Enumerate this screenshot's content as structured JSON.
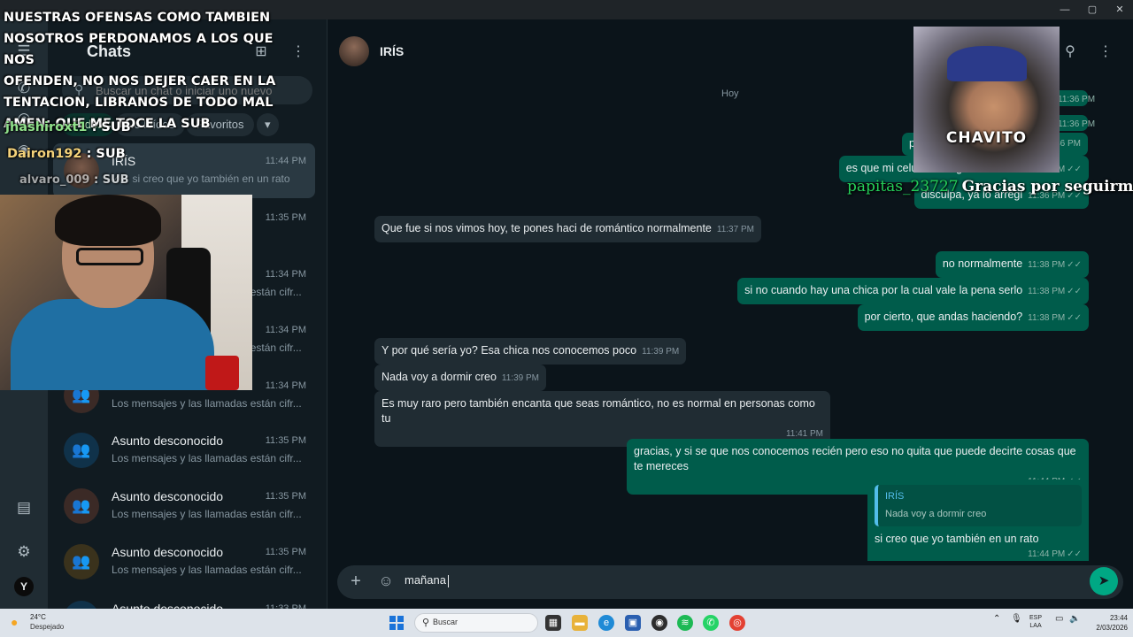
{
  "window": {
    "minimize": "—",
    "maximize": "▢",
    "close": "✕"
  },
  "sidebar_list": {
    "title": "Chats",
    "search_placeholder": "Buscar un chat o iniciar uno nuevo",
    "filters": [
      "Todos",
      "No leídos",
      "Favoritos"
    ],
    "chats": [
      {
        "name": "IRÍS",
        "time": "11:44 PM",
        "preview": "✓✓ si creo que yo también en un rato",
        "avatar": "photo",
        "selected": true
      },
      {
        "name": "",
        "time": "11:35 PM",
        "preview": "",
        "avatar": "blue"
      },
      {
        "name": "",
        "time": "11:34 PM",
        "preview": "Los mensajes y las llamadas están cifr...",
        "avatar": "blue"
      },
      {
        "name": "",
        "time": "11:34 PM",
        "preview": "Los mensajes y las llamadas están cifr...",
        "avatar": "gold"
      },
      {
        "name": "",
        "time": "11:34 PM",
        "preview": "Los mensajes y las llamadas están cifr...",
        "avatar": "brown"
      },
      {
        "name": "Asunto desconocido",
        "time": "11:35 PM",
        "preview": "Los mensajes y las llamadas están cifr...",
        "avatar": "blue"
      },
      {
        "name": "Asunto desconocido",
        "time": "11:35 PM",
        "preview": "Los mensajes y las llamadas están cifr...",
        "avatar": "brown"
      },
      {
        "name": "Asunto desconocido",
        "time": "11:35 PM",
        "preview": "Los mensajes y las llamadas están cifr...",
        "avatar": "gold"
      },
      {
        "name": "Asunto desconocido",
        "time": "11:33 PM",
        "preview": "",
        "avatar": "blue"
      }
    ]
  },
  "conversation": {
    "contact_name": "IRÍS",
    "day_label": "Hoy",
    "messages": [
      {
        "dir": "out",
        "text": "es que mi celular se lagea cuando c",
        "time": "11:36 PM"
      },
      {
        "dir": "out",
        "text": "disculpa, ya lo arregl",
        "time": "11:36 PM"
      },
      {
        "dir": "in",
        "text": "Que fue si nos vimos hoy, te pones haci de romántico normalmente",
        "time": "11:37 PM"
      },
      {
        "dir": "out",
        "text": "no normalmente",
        "time": "11:38 PM"
      },
      {
        "dir": "out",
        "text": "si no cuando hay una chica por la cual vale la pena serlo",
        "time": "11:38 PM"
      },
      {
        "dir": "out",
        "text": "por cierto, que andas haciendo?",
        "time": "11:38 PM"
      },
      {
        "dir": "in",
        "text": "Y por qué sería yo? Esa chica nos conocemos poco",
        "time": "11:39 PM"
      },
      {
        "dir": "in",
        "text": "Nada voy a dormir creo",
        "time": "11:39 PM"
      },
      {
        "dir": "in",
        "text": "Es muy raro pero también encanta que seas romántico, no es normal en personas como tu",
        "time": "11:41 PM"
      },
      {
        "dir": "out",
        "text": "gracias, y si se que nos conocemos recién pero eso no quita que puede decirte cosas que te mereces",
        "time": "11:44 PM"
      },
      {
        "dir": "out",
        "text": "si creo que yo también en un rato",
        "time": "11:44 PM",
        "quote_name": "IRÍS",
        "quote_text": "Nada voy a dormir creo"
      }
    ],
    "hidden_times": [
      "11:36 PM",
      "11:36 PM",
      "11:36 PM"
    ],
    "composer_value": "mañana"
  },
  "overlay": {
    "prayer_lines": [
      "NOSOTROS PERDONAMOS A LOS QUE NOS",
      "OFENDEN, NO NOS DEJER CAER EN LA",
      "TENTACION, LIBRANOS DE TODO MAL",
      "AMEN: QUE ME TOCE LA SUB"
    ],
    "prayer_top": "NUESTRAS OFENSAS COMO TAMBIEN",
    "chat": [
      {
        "user": "jhashiroxt1",
        "text": ": SUB"
      },
      {
        "user": "Dairon192",
        "text": ": SUB"
      },
      {
        "user": "alvaro_009",
        "text": ": SUB"
      }
    ],
    "cam2_label": "CHAVITO",
    "follow_user": "papitas_23727",
    "follow_text": "Gracias por seguirme!!"
  },
  "taskbar": {
    "temp": "24°C",
    "weather": "Despejado",
    "search": "Buscar",
    "lang": [
      "ESP",
      "LAA"
    ],
    "time": "23:44",
    "date": "2/03/2026"
  }
}
